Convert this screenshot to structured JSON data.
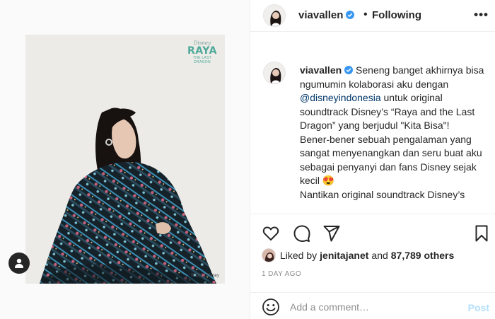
{
  "colors": {
    "link": "#00376b",
    "verified": "#3897f0",
    "muted": "#8e8e8e",
    "post_disabled": "#b2dffc"
  },
  "media": {
    "logo_brand": "Disney",
    "logo_title": "RAYA",
    "logo_subtitle": "THE LAST DRAGON",
    "copyright": "© 2021 Disney"
  },
  "header": {
    "username": "viavallen",
    "separator": "•",
    "follow_status": "Following",
    "more_icon": "more-horizontal-icon"
  },
  "caption": {
    "username": "viavallen",
    "text_before_mention": " Seneng banget akhirnya bisa ngumumin kolaborasi aku dengan ",
    "mention": "@disneyindonesia",
    "text_after_mention": " untuk original soundtrack Disney’s “Raya and the Last Dragon” yang berjudul \"Kita Bisa\"!",
    "paragraph2": "Bener-bener sebuah pengalaman yang sangat menyenangkan dan seru buat aku sebagai penyanyi dan fans Disney sejak kecil 😍",
    "paragraph3": "Nantikan original soundtrack Disney’s"
  },
  "actions": {
    "icons": [
      "heart-icon",
      "comment-icon",
      "share-icon",
      "bookmark-icon"
    ],
    "liked_prefix": "Liked by",
    "liked_user": "jenitajanet",
    "liked_middle": "and",
    "liked_count": "87,789 others",
    "time_ago": "1 DAY AGO"
  },
  "comment": {
    "placeholder": "Add a comment…",
    "post_label": "Post"
  }
}
